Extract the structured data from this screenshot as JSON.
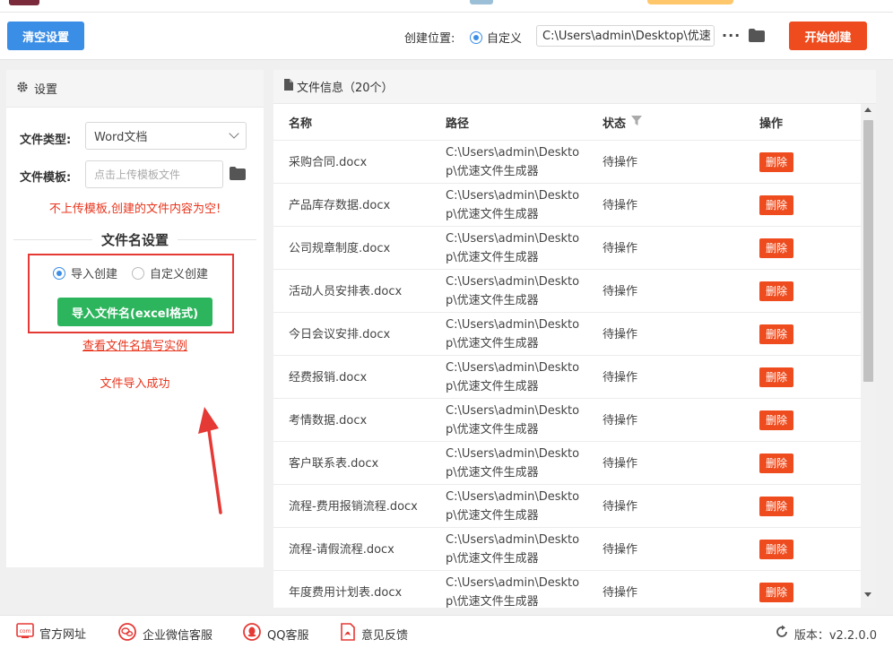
{
  "toolbar": {
    "clear_label": "清空设置",
    "location_label": "创建位置:",
    "custom_label": "自定义",
    "path_value": "C:\\Users\\admin\\Desktop\\优速",
    "more_label": "···",
    "start_label": "开始创建"
  },
  "settings": {
    "header": "设置",
    "file_type_label": "文件类型:",
    "file_type_value": "Word文档",
    "template_label": "文件模板:",
    "template_placeholder": "点击上传模板文件",
    "warning": "不上传模板,创建的文件内容为空!",
    "filename_title": "文件名设置",
    "mode_import": "导入创建",
    "mode_custom": "自定义创建",
    "import_button": "导入文件名(excel格式)",
    "example_link": "查看文件名填写实例",
    "success": "文件导入成功"
  },
  "fileinfo": {
    "header": "文件信息（20个）",
    "columns": {
      "name": "名称",
      "path": "路径",
      "status": "状态",
      "op": "操作"
    },
    "delete_label": "删除",
    "rows": [
      {
        "name": "采购合同.docx",
        "path": "C:\\Users\\admin\\Desktop\\优速文件生成器",
        "status": "待操作"
      },
      {
        "name": "产品库存数据.docx",
        "path": "C:\\Users\\admin\\Desktop\\优速文件生成器",
        "status": "待操作"
      },
      {
        "name": "公司规章制度.docx",
        "path": "C:\\Users\\admin\\Desktop\\优速文件生成器",
        "status": "待操作"
      },
      {
        "name": "活动人员安排表.docx",
        "path": "C:\\Users\\admin\\Desktop\\优速文件生成器",
        "status": "待操作"
      },
      {
        "name": "今日会议安排.docx",
        "path": "C:\\Users\\admin\\Desktop\\优速文件生成器",
        "status": "待操作"
      },
      {
        "name": "经费报销.docx",
        "path": "C:\\Users\\admin\\Desktop\\优速文件生成器",
        "status": "待操作"
      },
      {
        "name": "考情数据.docx",
        "path": "C:\\Users\\admin\\Desktop\\优速文件生成器",
        "status": "待操作"
      },
      {
        "name": "客户联系表.docx",
        "path": "C:\\Users\\admin\\Desktop\\优速文件生成器",
        "status": "待操作"
      },
      {
        "name": "流程-费用报销流程.docx",
        "path": "C:\\Users\\admin\\Desktop\\优速文件生成器",
        "status": "待操作"
      },
      {
        "name": "流程-请假流程.docx",
        "path": "C:\\Users\\admin\\Desktop\\优速文件生成器",
        "status": "待操作"
      },
      {
        "name": "年度费用计划表.docx",
        "path": "C:\\Users\\admin\\Desktop\\优速文件生成器",
        "status": "待操作"
      }
    ]
  },
  "footer": {
    "website": "官方网址",
    "wechat": "企业微信客服",
    "qq": "QQ客服",
    "feedback": "意见反馈",
    "version": "版本：v2.2.0.0"
  },
  "colors": {
    "blue": "#3a8ee6",
    "orange_red": "#ee4c1e",
    "green": "#2db55d",
    "warning_red": "#e8341c"
  },
  "icons": {
    "settings": "gear-icon",
    "file": "file-icon",
    "folder": "folder-icon",
    "filter": "filter-icon",
    "refresh": "refresh-icon"
  }
}
